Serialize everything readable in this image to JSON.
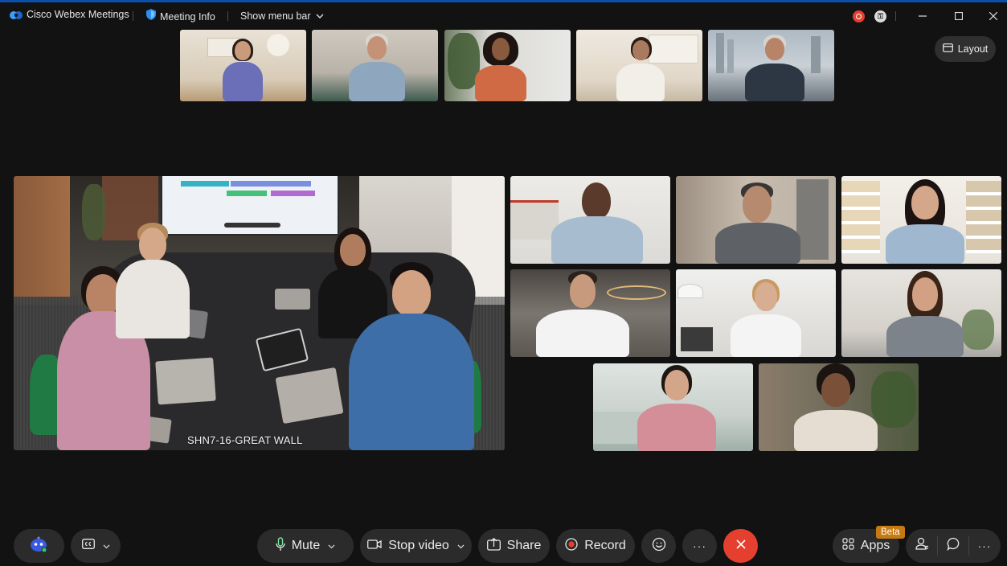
{
  "title_bar": {
    "app_name": "Cisco Webex Meetings",
    "meeting_info": "Meeting Info",
    "show_menu_bar": "Show menu bar"
  },
  "layout_button": {
    "label": "Layout"
  },
  "room_tile": {
    "label": "SHN7-16-GREAT WALL"
  },
  "controls": {
    "mute": "Mute",
    "stop_video": "Stop video",
    "share": "Share",
    "record": "Record",
    "apps": "Apps",
    "apps_badge": "Beta",
    "more": "···"
  },
  "colors": {
    "background": "#121212",
    "control_bg": "#2b2b2b",
    "end_call": "#e5402f",
    "record_dot": "#e5402f",
    "beta_badge": "#c77a12",
    "title_stripe": "#0b4fa8"
  },
  "icons": [
    "webex-logo-icon",
    "shield-icon",
    "chevron-down-icon",
    "minimize-icon",
    "maximize-icon",
    "close-icon",
    "layout-icon",
    "assistant-icon",
    "captions-icon",
    "microphone-icon",
    "camera-icon",
    "share-icon",
    "record-icon",
    "reactions-icon",
    "more-icon",
    "end-call-icon",
    "apps-icon",
    "participants-icon",
    "chat-icon"
  ]
}
